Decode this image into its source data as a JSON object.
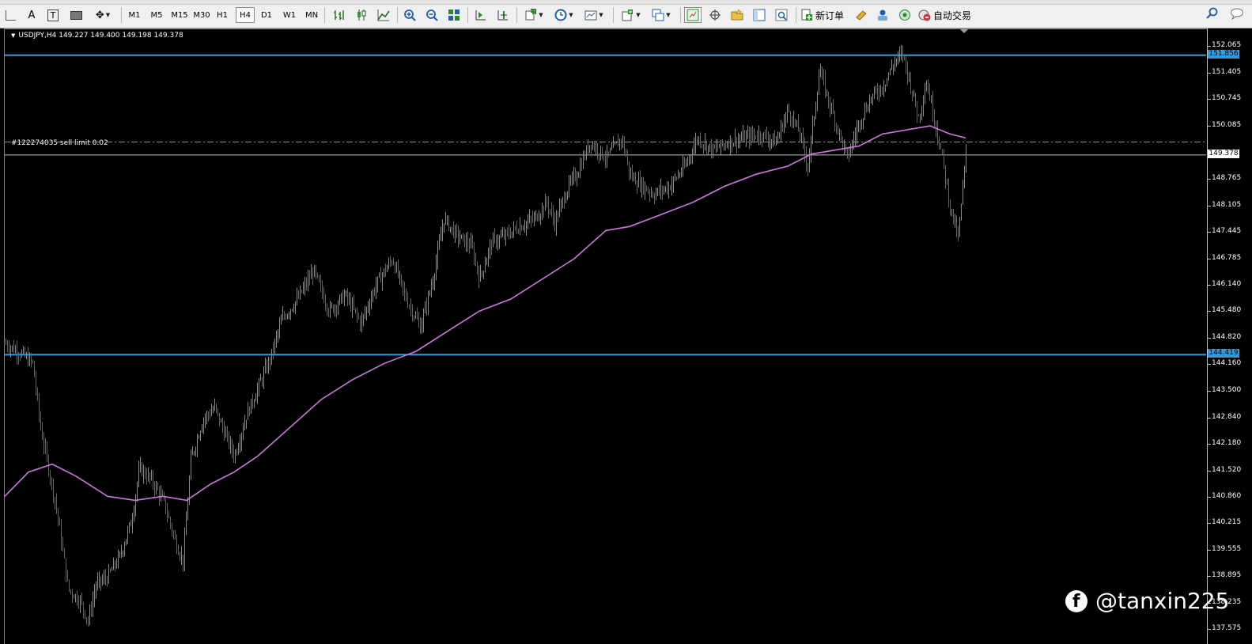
{
  "toolbar": {
    "timeframes": [
      "M1",
      "M5",
      "M15",
      "M30",
      "H1",
      "H4",
      "D1",
      "W1",
      "MN"
    ],
    "active_timeframe": "H4",
    "new_order_label": "新订单",
    "auto_trading_label": "自动交易"
  },
  "chart": {
    "symbol_info": "USDJPY,H4  149.227 149.400 149.198 149.378",
    "order_label": "#122274035 sell limit 0.02",
    "y_range": [
      137.25,
      152.5
    ],
    "y_ticks": [
      "152.065",
      "151.405",
      "150.745",
      "150.085",
      "148.765",
      "148.105",
      "147.445",
      "146.785",
      "146.140",
      "145.480",
      "144.820",
      "144.160",
      "143.500",
      "142.840",
      "142.180",
      "141.520",
      "140.860",
      "140.215",
      "139.555",
      "138.895",
      "138.235",
      "137.575"
    ],
    "hline_resistance": "151.856",
    "hline_support": "144.419",
    "current_price": "149.378",
    "sell_limit_price": 149.7,
    "colors": {
      "background": "#000000",
      "bull_candle": "#3fbf3f",
      "bear_candle": "#d23333",
      "moving_average": "#cc77dd",
      "hline": "#3399dd",
      "order_line": "#8a9a5b",
      "price_line": "#c0c0c0"
    },
    "price_path": [
      [
        0,
        144.7
      ],
      [
        20,
        144.45
      ],
      [
        35,
        144.2
      ],
      [
        45,
        142.6
      ],
      [
        55,
        141.6
      ],
      [
        65,
        140.6
      ],
      [
        80,
        138.6
      ],
      [
        95,
        138.3
      ],
      [
        105,
        137.8
      ],
      [
        115,
        138.7
      ],
      [
        130,
        138.9
      ],
      [
        145,
        139.4
      ],
      [
        160,
        140.3
      ],
      [
        170,
        141.6
      ],
      [
        185,
        141.3
      ],
      [
        200,
        140.8
      ],
      [
        215,
        139.8
      ],
      [
        225,
        139.3
      ],
      [
        235,
        141.8
      ],
      [
        250,
        142.8
      ],
      [
        265,
        143.1
      ],
      [
        275,
        142.6
      ],
      [
        290,
        141.9
      ],
      [
        305,
        142.9
      ],
      [
        320,
        143.6
      ],
      [
        335,
        144.3
      ],
      [
        350,
        145.3
      ],
      [
        370,
        145.8
      ],
      [
        390,
        146.5
      ],
      [
        410,
        145.5
      ],
      [
        430,
        145.9
      ],
      [
        450,
        145.2
      ],
      [
        470,
        146.2
      ],
      [
        490,
        146.8
      ],
      [
        505,
        145.9
      ],
      [
        525,
        145.1
      ],
      [
        540,
        146.2
      ],
      [
        555,
        147.8
      ],
      [
        570,
        147.4
      ],
      [
        590,
        147.1
      ],
      [
        600,
        146.3
      ],
      [
        615,
        147.2
      ],
      [
        635,
        147.4
      ],
      [
        650,
        147.6
      ],
      [
        670,
        147.8
      ],
      [
        685,
        148.2
      ],
      [
        695,
        147.7
      ],
      [
        710,
        148.5
      ],
      [
        725,
        149.0
      ],
      [
        740,
        149.7
      ],
      [
        760,
        149.3
      ],
      [
        780,
        149.8
      ],
      [
        790,
        148.9
      ],
      [
        800,
        148.7
      ],
      [
        820,
        148.4
      ],
      [
        840,
        148.6
      ],
      [
        860,
        149.1
      ],
      [
        875,
        149.8
      ],
      [
        895,
        149.5
      ],
      [
        915,
        149.7
      ],
      [
        935,
        149.8
      ],
      [
        955,
        149.9
      ],
      [
        975,
        149.7
      ],
      [
        990,
        150.5
      ],
      [
        1005,
        149.9
      ],
      [
        1015,
        149.1
      ],
      [
        1030,
        151.5
      ],
      [
        1040,
        150.8
      ],
      [
        1055,
        149.9
      ],
      [
        1065,
        149.3
      ],
      [
        1080,
        150.2
      ],
      [
        1095,
        150.8
      ],
      [
        1110,
        151.1
      ],
      [
        1125,
        151.7
      ],
      [
        1135,
        151.9
      ],
      [
        1145,
        151.1
      ],
      [
        1155,
        150.3
      ],
      [
        1165,
        151.2
      ],
      [
        1175,
        150.3
      ],
      [
        1185,
        149.3
      ],
      [
        1195,
        148.1
      ],
      [
        1205,
        147.3
      ],
      [
        1215,
        149.4
      ]
    ],
    "ma_path": [
      [
        0,
        140.9
      ],
      [
        30,
        141.5
      ],
      [
        60,
        141.7
      ],
      [
        90,
        141.4
      ],
      [
        130,
        140.9
      ],
      [
        165,
        140.8
      ],
      [
        200,
        140.9
      ],
      [
        230,
        140.8
      ],
      [
        260,
        141.2
      ],
      [
        290,
        141.5
      ],
      [
        320,
        141.9
      ],
      [
        360,
        142.6
      ],
      [
        400,
        143.3
      ],
      [
        440,
        143.8
      ],
      [
        480,
        144.2
      ],
      [
        520,
        144.5
      ],
      [
        560,
        145.0
      ],
      [
        600,
        145.5
      ],
      [
        640,
        145.8
      ],
      [
        680,
        146.3
      ],
      [
        720,
        146.8
      ],
      [
        760,
        147.5
      ],
      [
        790,
        147.6
      ],
      [
        830,
        147.9
      ],
      [
        870,
        148.2
      ],
      [
        910,
        148.6
      ],
      [
        950,
        148.9
      ],
      [
        990,
        149.1
      ],
      [
        1020,
        149.4
      ],
      [
        1050,
        149.5
      ],
      [
        1080,
        149.6
      ],
      [
        1110,
        149.9
      ],
      [
        1140,
        150.0
      ],
      [
        1170,
        150.1
      ],
      [
        1195,
        149.9
      ],
      [
        1215,
        149.8
      ]
    ]
  },
  "watermark": {
    "handle": "@tanxin225"
  }
}
